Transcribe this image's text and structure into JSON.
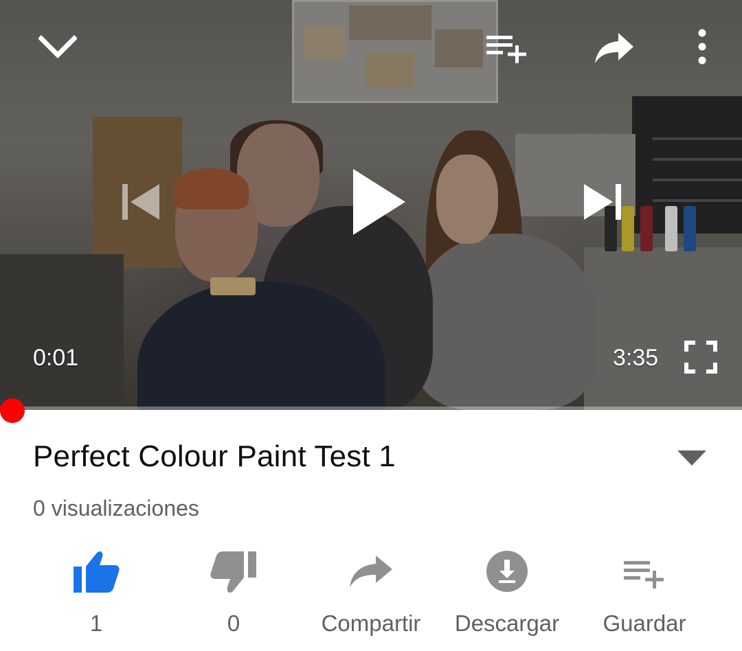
{
  "player": {
    "current_time": "0:01",
    "duration": "3:35",
    "progress_fraction": 0.005,
    "accent_color": "#ff0000",
    "controls": {
      "collapse_icon": "chevron-down-icon",
      "add_to_queue_icon": "playlist-add-icon",
      "share_icon": "share-icon",
      "more_icon": "more-vert-icon",
      "previous_icon": "skip-previous-icon",
      "play_icon": "play-icon",
      "next_icon": "skip-next-icon",
      "fullscreen_icon": "fullscreen-icon"
    }
  },
  "video": {
    "title": "Perfect Colour Paint Test 1",
    "views": "0 visualizaciones",
    "expand_icon": "triangle-down-icon"
  },
  "actions": [
    {
      "icon": "thumb-up-icon",
      "label": "1",
      "active": true,
      "color": "#1a73e8"
    },
    {
      "icon": "thumb-down-icon",
      "label": "0",
      "active": false,
      "color": "#909090"
    },
    {
      "icon": "share-icon",
      "label": "Compartir",
      "active": false,
      "color": "#909090"
    },
    {
      "icon": "download-icon",
      "label": "Descargar",
      "active": false,
      "color": "#909090"
    },
    {
      "icon": "playlist-add-icon",
      "label": "Guardar",
      "active": false,
      "color": "#909090"
    }
  ]
}
